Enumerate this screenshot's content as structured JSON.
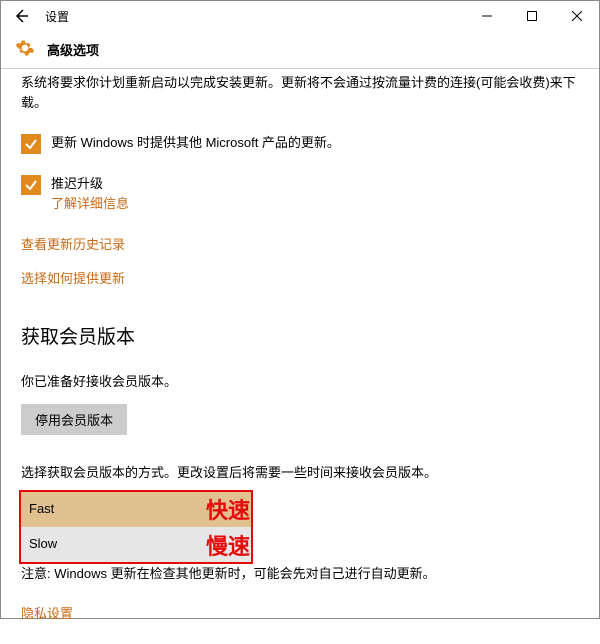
{
  "titlebar": {
    "title": "设置"
  },
  "subheader": {
    "title": "高级选项"
  },
  "intro": "系统将要求你计划重新启动以完成安装更新。更新将不会通过按流量计费的连接(可能会收费)来下载。",
  "cb1": {
    "label": "更新 Windows 时提供其他 Microsoft 产品的更新。"
  },
  "cb2": {
    "label": "推迟升级",
    "link": "了解详细信息"
  },
  "links": {
    "history": "查看更新历史记录",
    "delivery": "选择如何提供更新"
  },
  "insider": {
    "heading": "获取会员版本",
    "status": "你已准备好接收会员版本。",
    "disable_btn": "停用会员版本",
    "select_desc": "选择获取会员版本的方式。更改设置后将需要一些时间来接收会员版本。",
    "options": {
      "fast": "Fast",
      "slow": "Slow"
    },
    "annotations": {
      "fast": "快速",
      "slow": "慢速"
    },
    "note": "注意: Windows 更新在检查其他更新时，可能会先对自己进行自动更新。",
    "privacy": "隐私设置"
  }
}
